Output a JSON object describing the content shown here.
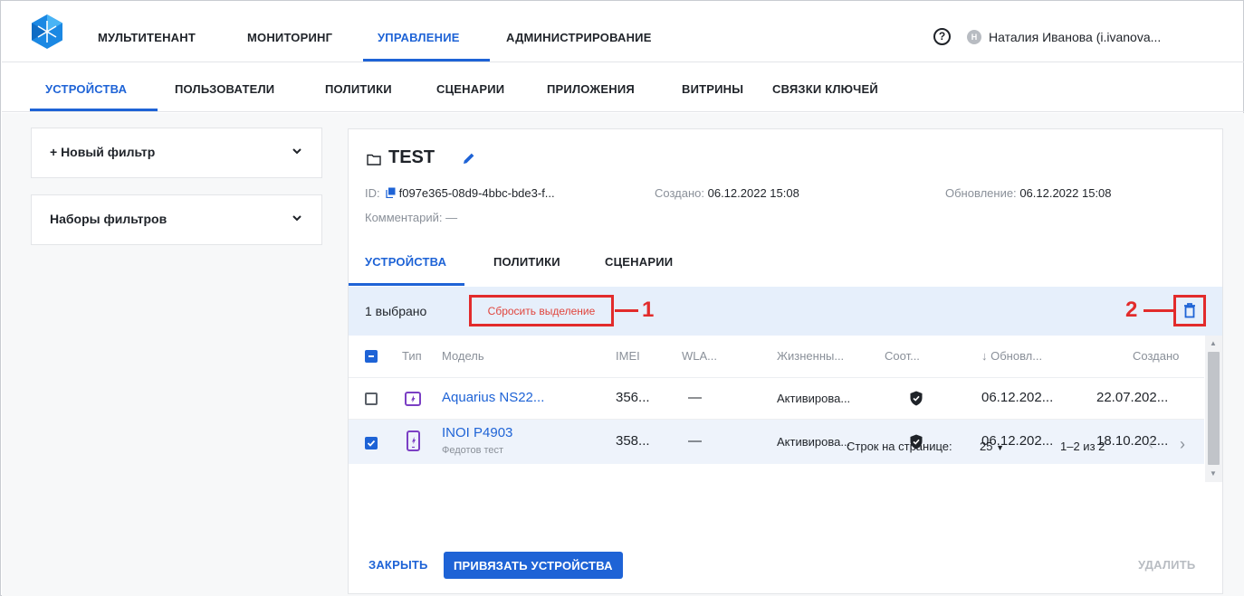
{
  "topnav": {
    "items": [
      "МУЛЬТИТЕНАНТ",
      "МОНИТОРИНГ",
      "УПРАВЛЕНИЕ",
      "АДМИНИСТРИРОВАНИЕ"
    ],
    "active": "УПРАВЛЕНИЕ",
    "help_glyph": "?",
    "avatar_letter": "Н",
    "user": "Наталия Иванова (i.ivanova..."
  },
  "subnav": {
    "items": [
      "УСТРОЙСТВА",
      "ПОЛЬЗОВАТЕЛИ",
      "ПОЛИТИКИ",
      "СЦЕНАРИИ",
      "ПРИЛОЖЕНИЯ",
      "ВИТРИНЫ",
      "СВЯЗКИ КЛЮЧЕЙ"
    ],
    "active": "УСТРОЙСТВА"
  },
  "filters": {
    "new_filter": "+ Новый фильтр",
    "filter_sets": "Наборы фильтров"
  },
  "group": {
    "title": "TEST",
    "id_label": "ID:",
    "id_value": "f097e365-08d9-4bbc-bde3-f...",
    "created_label": "Создано:",
    "created_value": "06.12.2022 15:08",
    "updated_label": "Обновление:",
    "updated_value": "06.12.2022 15:08",
    "comment": "Комментарий: —"
  },
  "tabs": [
    "УСТРОЙСТВА",
    "ПОЛИТИКИ",
    "СЦЕНАРИИ"
  ],
  "selection": {
    "count_text": "1 выбрано",
    "reset_label": "Сбросить выделение",
    "callout_1": "1",
    "callout_2": "2"
  },
  "table": {
    "columns": [
      "Тип",
      "Модель",
      "IMEI",
      "WLA...",
      "Жизненны...",
      "Соот...",
      "↓ Обновл...",
      "Создано"
    ],
    "rows": [
      {
        "selected": false,
        "model": "Aquarius NS22...",
        "sub": "",
        "imei": "356...",
        "wlan": "—",
        "lifecycle": "Активирова...",
        "updated": "06.12.202...",
        "created": "22.07.202..."
      },
      {
        "selected": true,
        "model": "INOI P4903",
        "sub": "Федотов тест",
        "imei": "358...",
        "wlan": "—",
        "lifecycle": "Активирова...",
        "updated": "06.12.202...",
        "created": "18.10.202..."
      }
    ]
  },
  "pagination": {
    "rows_label": "Строк на странице:",
    "rows_value": "25",
    "range": "1–2 из 2"
  },
  "footer": {
    "close": "ЗАКРЫТЬ",
    "bind": "ПРИВЯЗАТЬ УСТРОЙСТВА",
    "delete": "УДАЛИТЬ"
  },
  "colors": {
    "accent": "#1e63d6",
    "callout": "#e22b2b",
    "selection_bg": "#e6effb",
    "type_icon": "#7b3fc4"
  }
}
